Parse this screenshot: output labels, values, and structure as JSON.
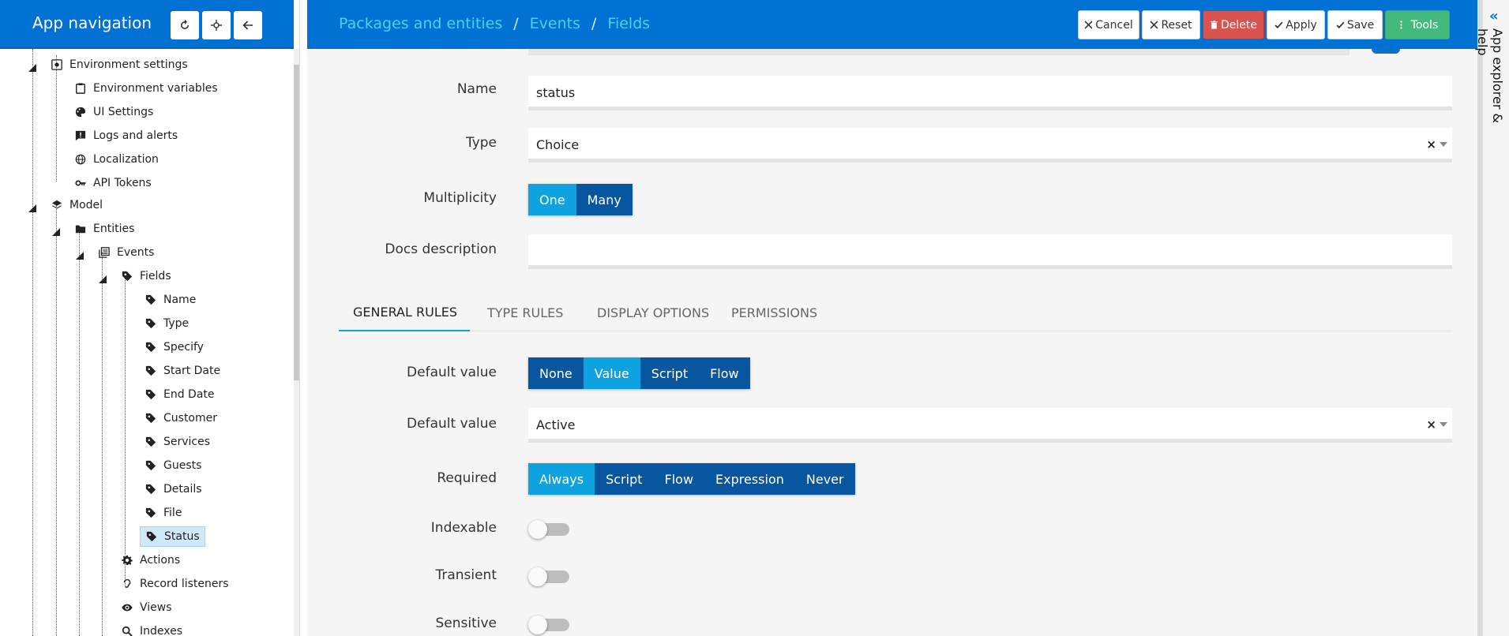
{
  "nav": {
    "title": "App navigation",
    "tree": [
      {
        "label": "Environment settings",
        "icon": "gear-box-icon"
      },
      {
        "label": "Environment variables",
        "icon": "clipboard-icon"
      },
      {
        "label": "UI Settings",
        "icon": "palette-icon"
      },
      {
        "label": "Logs and alerts",
        "icon": "message-alert-icon"
      },
      {
        "label": "Localization",
        "icon": "globe-icon"
      },
      {
        "label": "API Tokens",
        "icon": "key-icon"
      },
      {
        "label": "Model",
        "icon": "layers-icon"
      },
      {
        "label": "Entities",
        "icon": "folder-icon"
      },
      {
        "label": "Events",
        "icon": "table-icon"
      },
      {
        "label": "Fields",
        "icon": "tag-icon"
      },
      {
        "label": "Name",
        "icon": "tag-icon"
      },
      {
        "label": "Type",
        "icon": "tag-icon"
      },
      {
        "label": "Specify",
        "icon": "tag-icon"
      },
      {
        "label": "Start Date",
        "icon": "tag-icon"
      },
      {
        "label": "End Date",
        "icon": "tag-icon"
      },
      {
        "label": "Customer",
        "icon": "tag-icon"
      },
      {
        "label": "Services",
        "icon": "tag-icon"
      },
      {
        "label": "Guests",
        "icon": "tag-icon"
      },
      {
        "label": "Details",
        "icon": "tag-icon"
      },
      {
        "label": "File",
        "icon": "tag-icon"
      },
      {
        "label": "Status",
        "icon": "tag-icon"
      },
      {
        "label": "Actions",
        "icon": "cog-icon"
      },
      {
        "label": "Record listeners",
        "icon": "ear-icon"
      },
      {
        "label": "Views",
        "icon": "eye-icon"
      },
      {
        "label": "Indexes",
        "icon": "search-icon"
      }
    ]
  },
  "breadcrumb": [
    "Packages and entities",
    "Events",
    "Fields"
  ],
  "actions": {
    "cancel": "Cancel",
    "reset": "Reset",
    "delete": "Delete",
    "apply": "Apply",
    "save": "Save",
    "tools": "Tools"
  },
  "form": {
    "name_label": "Name",
    "name_value": "status",
    "type_label": "Type",
    "type_value": "Choice",
    "multiplicity_label": "Multiplicity",
    "multiplicity_options": [
      "One",
      "Many"
    ],
    "multiplicity_selected": "One",
    "docs_label": "Docs description",
    "docs_value": ""
  },
  "tabs": [
    "GENERAL RULES",
    "TYPE RULES",
    "DISPLAY OPTIONS",
    "PERMISSIONS"
  ],
  "active_tab": "GENERAL RULES",
  "rules": {
    "default_mode_label": "Default value",
    "default_mode_options": [
      "None",
      "Value",
      "Script",
      "Flow"
    ],
    "default_mode_selected": "Value",
    "default_value_label": "Default value",
    "default_value": "Active",
    "required_label": "Required",
    "required_options": [
      "Always",
      "Script",
      "Flow",
      "Expression",
      "Never"
    ],
    "required_selected": "Always",
    "indexable_label": "Indexable",
    "indexable": false,
    "transient_label": "Transient",
    "transient": false,
    "sensitive_label": "Sensitive",
    "sensitive": false
  },
  "side_panel": {
    "label": "App explorer & help"
  },
  "colors": {
    "header": "#0171d3",
    "accent": "#0ea3e0",
    "segment": "#0956a0",
    "delete": "#d9534f",
    "tools": "#44b97b"
  }
}
